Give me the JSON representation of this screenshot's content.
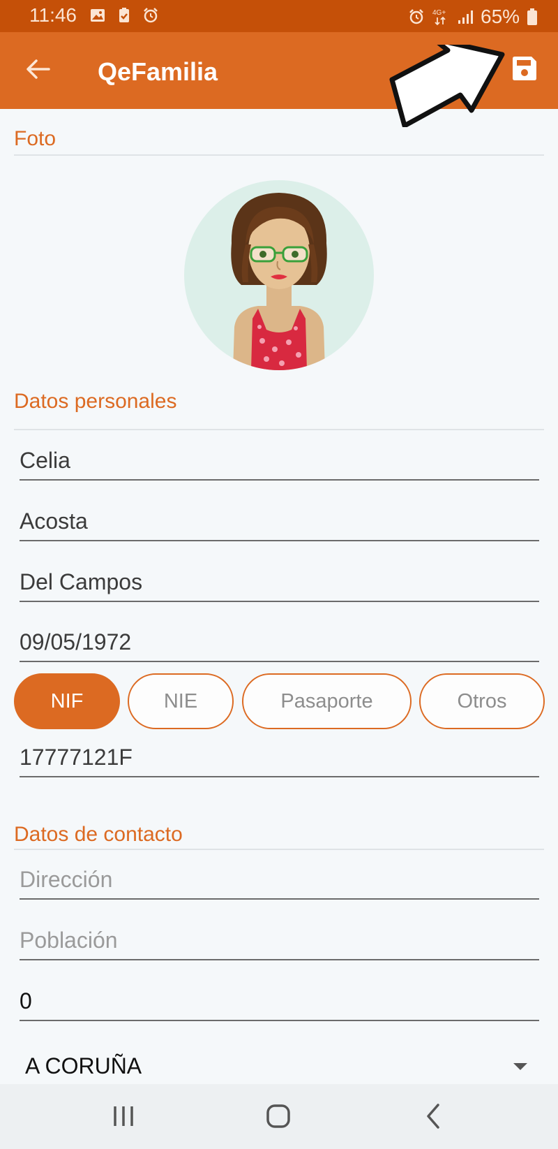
{
  "status_bar": {
    "time": "11:46",
    "battery": "65%",
    "network": "4G+"
  },
  "app_bar": {
    "title": "QeFamilia"
  },
  "sections": {
    "foto": "Foto",
    "personal": "Datos personales",
    "contact": "Datos de contacto"
  },
  "personal": {
    "first_name": "Celia",
    "last_name_1": "Acosta",
    "last_name_2": "Del Campos",
    "birth_date": "09/05/1972",
    "doc_types": [
      {
        "label": "NIF",
        "selected": true
      },
      {
        "label": "NIE",
        "selected": false
      },
      {
        "label": "Pasaporte",
        "selected": false
      },
      {
        "label": "Otros",
        "selected": false
      }
    ],
    "doc_number": "17777121F"
  },
  "contact": {
    "address_placeholder": "Dirección",
    "town_placeholder": "Población",
    "postal_code": "0",
    "province": "A CORUÑA"
  },
  "colors": {
    "primary": "#dc6a22",
    "status_bar": "#c55008",
    "background": "#f5f8fa"
  }
}
